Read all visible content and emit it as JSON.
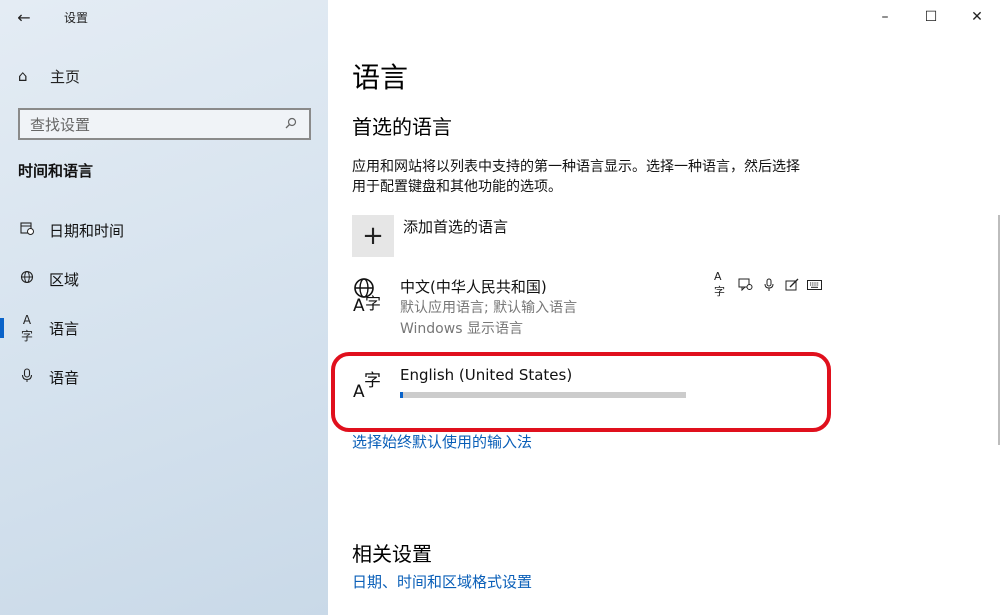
{
  "window": {
    "title": "设置",
    "controls": {
      "minimize": "–",
      "maximize": "☐",
      "close": "✕"
    }
  },
  "sidebar": {
    "home_label": "主页",
    "search_placeholder": "查找设置",
    "section_title": "时间和语言",
    "items": [
      {
        "label": "日期和时间",
        "icon": "calendar-clock-icon",
        "active": false
      },
      {
        "label": "区域",
        "icon": "globe-region-icon",
        "active": false
      },
      {
        "label": "语言",
        "icon": "language-icon",
        "active": true
      },
      {
        "label": "语音",
        "icon": "microphone-icon",
        "active": false
      }
    ]
  },
  "main": {
    "page_title": "语言",
    "preferred_title": "首选的语言",
    "description": "应用和网站将以列表中支持的第一种语言显示。选择一种语言，然后选择用于配置键盘和其他功能的选项。",
    "add_language_label": "添加首选的语言",
    "languages": [
      {
        "name": "中文(中华人民共和国)",
        "sub1": "默认应用语言; 默认输入语言",
        "sub2": "Windows 显示语言",
        "feature_icons": [
          "display-language-icon",
          "speech-icon",
          "microphone-icon",
          "handwriting-icon",
          "keyboard-icon"
        ]
      },
      {
        "name": "English (United States)",
        "download_progress": 0.01
      }
    ],
    "input_method_link": "选择始终默认使用的输入法",
    "related_title": "相关设置",
    "related_link": "日期、时间和区域格式设置"
  },
  "colors": {
    "accent": "#0a63c9",
    "link": "#0a5fb8",
    "highlight_ring": "#e0101d"
  }
}
